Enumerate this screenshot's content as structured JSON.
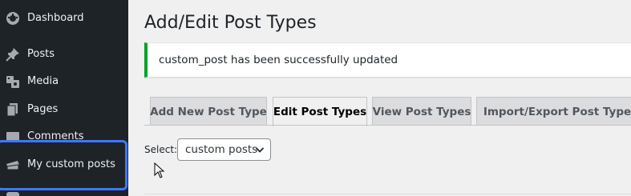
{
  "sidebar": {
    "items": [
      {
        "label": "Dashboard",
        "icon": "dashboard-icon"
      },
      {
        "label": "Posts",
        "icon": "pin-icon"
      },
      {
        "label": "Media",
        "icon": "media-icon"
      },
      {
        "label": "Pages",
        "icon": "pages-icon"
      },
      {
        "label": "Comments",
        "icon": "comments-icon"
      },
      {
        "label": "My custom posts",
        "icon": "custom-posts-icon"
      }
    ]
  },
  "main": {
    "title": "Add/Edit Post Types",
    "notice": "custom_post has been successfully updated",
    "tabs": [
      {
        "label": "Add New Post Type",
        "active": false
      },
      {
        "label": "Edit Post Types",
        "active": true
      },
      {
        "label": "View Post Types",
        "active": false
      },
      {
        "label": "Import/Export Post Types",
        "active": false
      }
    ],
    "select": {
      "label": "Select:",
      "value": "custom posts"
    }
  },
  "colors": {
    "sidebar_bg": "#1d2327",
    "highlight": "#3e78ff",
    "notice_success": "#00a32a",
    "page_bg": "#f0f0f1"
  }
}
